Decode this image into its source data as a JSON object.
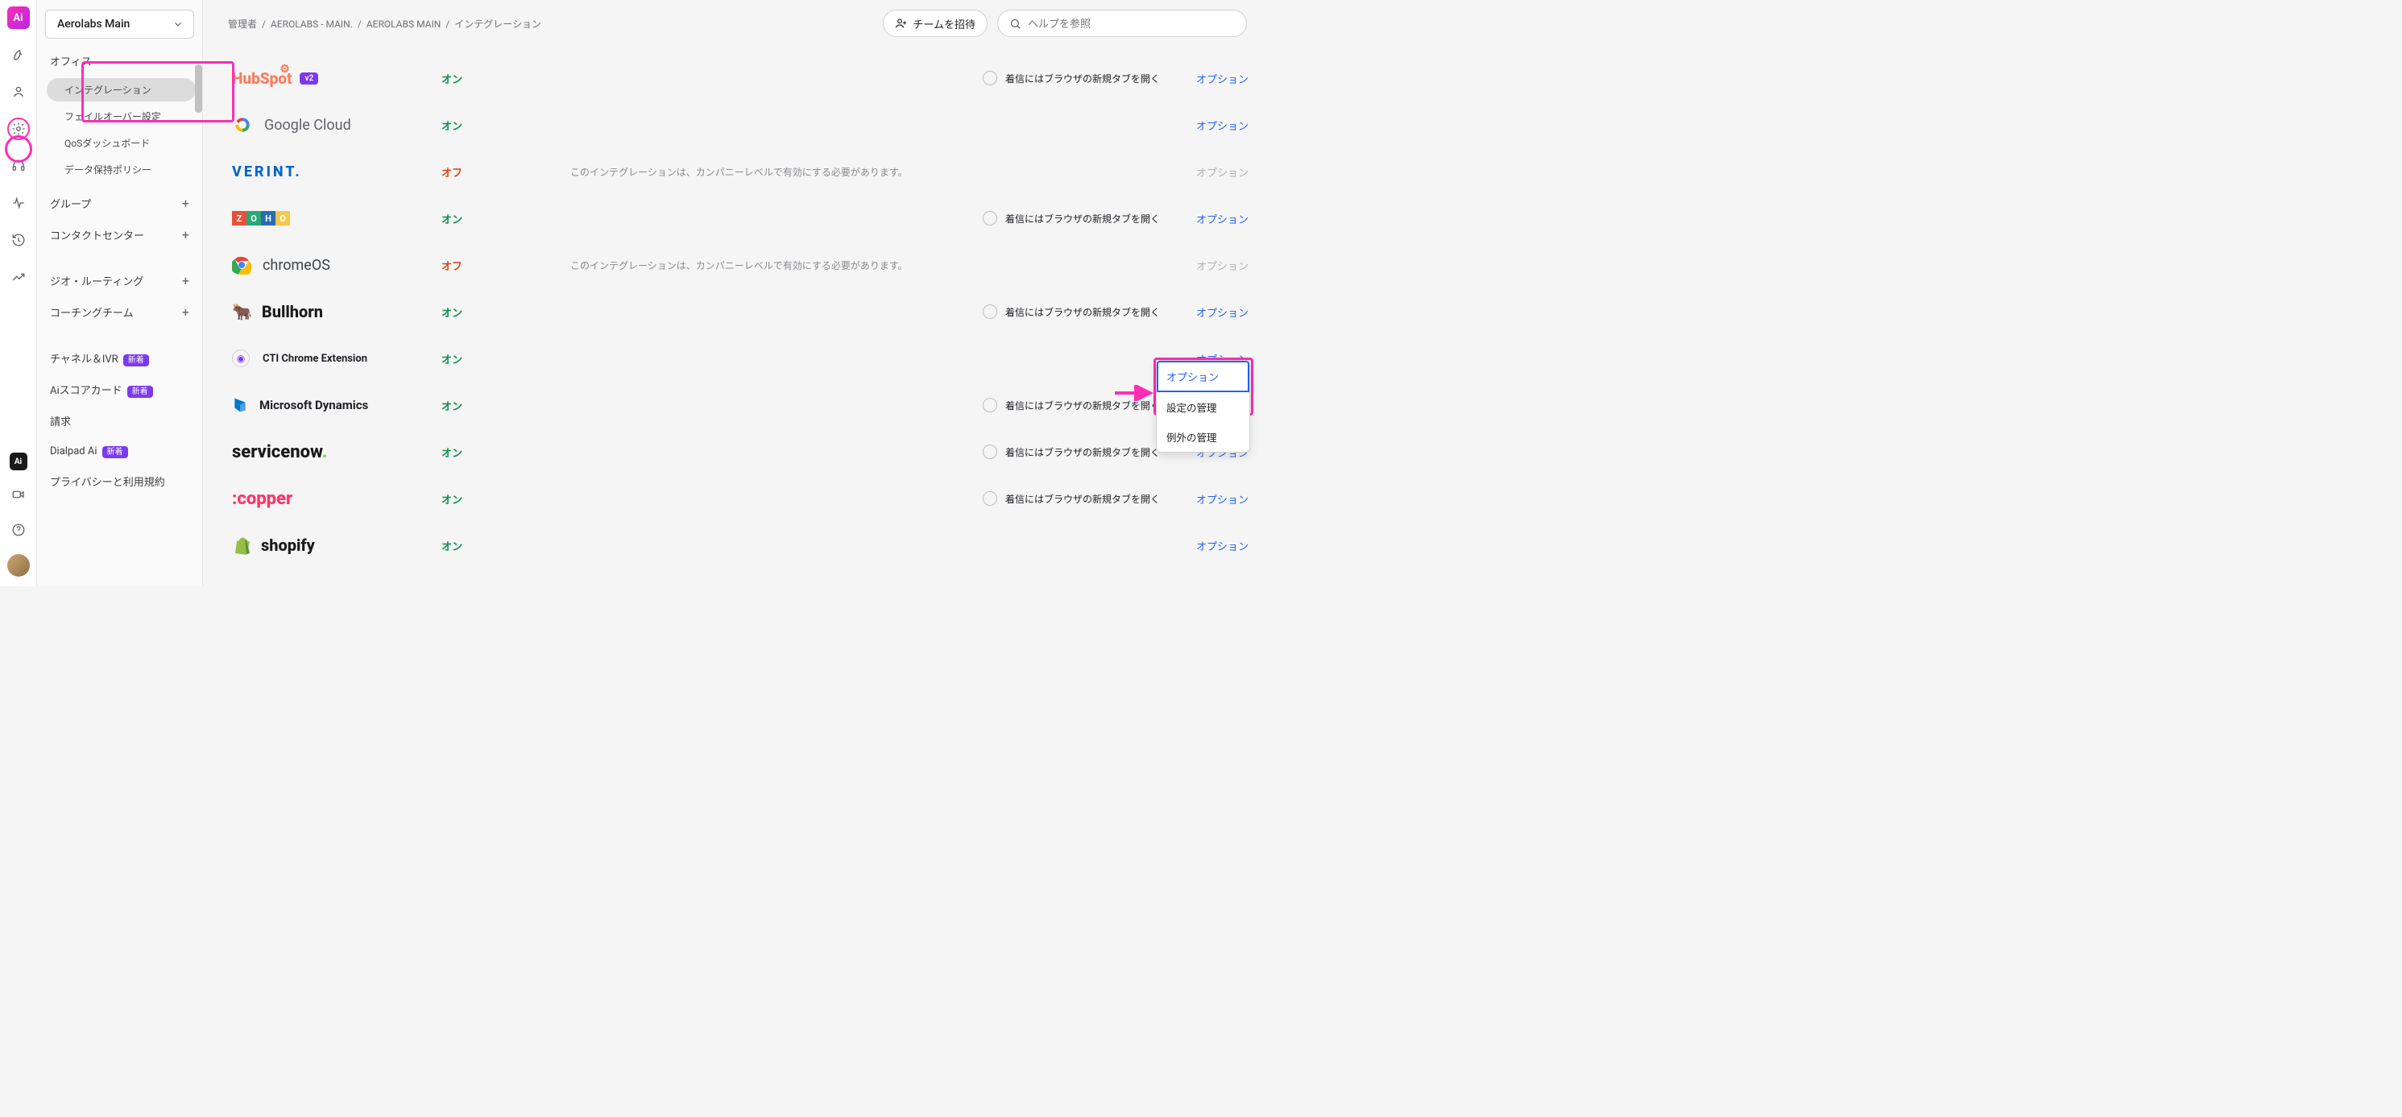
{
  "workspace": "Aerolabs Main",
  "breadcrumb": [
    "管理者",
    "AEROLABS - MAIN.",
    "AEROLABS MAIN",
    "インテグレーション"
  ],
  "invite_label": "チームを招待",
  "search_placeholder": "ヘルプを参照",
  "sidebar": {
    "office": "オフィス",
    "subs": [
      "インテグレーション",
      "フェイルオーバー設定",
      "QoSダッシュボード",
      "データ保持ポリシー"
    ],
    "items": [
      {
        "label": "グループ",
        "plus": true
      },
      {
        "label": "コンタクトセンター",
        "plus": true
      },
      {
        "label": "ジオ・ルーティング",
        "plus": true
      },
      {
        "label": "コーチングチーム",
        "plus": true
      },
      {
        "label": "チャネル＆IVR",
        "badge": "新着"
      },
      {
        "label": "Aiスコアカード",
        "badge": "新着"
      },
      {
        "label": "請求"
      },
      {
        "label": "Dialpad Ai",
        "badge": "新着"
      },
      {
        "label": "プライバシーと利用規約"
      }
    ]
  },
  "options_label": "オプション",
  "toggle_note": "着信にはブラウザの新規タブを開く",
  "company_note": "このインテグレーションは、カンパニーレベルで有効にする必要があります。",
  "status": {
    "on": "オン",
    "off": "オフ"
  },
  "dropdown": {
    "top": "オプション",
    "items": [
      "設定の管理",
      "例外の管理"
    ]
  },
  "integrations": [
    {
      "name": "HubSpot",
      "status": "on",
      "toggle": true,
      "opt": true,
      "v2": true
    },
    {
      "name": "Google Cloud",
      "status": "on",
      "toggle": false,
      "opt": true
    },
    {
      "name": "VERINT",
      "status": "off",
      "note": true,
      "opt": false
    },
    {
      "name": "Zoho",
      "status": "on",
      "toggle": true,
      "opt": true
    },
    {
      "name": "chromeOS",
      "status": "off",
      "note": true,
      "opt": false
    },
    {
      "name": "Bullhorn",
      "status": "on",
      "toggle": true,
      "opt": true
    },
    {
      "name": "CTI Chrome Extension",
      "status": "on",
      "toggle": false,
      "opt": true
    },
    {
      "name": "Microsoft Dynamics",
      "status": "on",
      "toggle": true,
      "opt": true
    },
    {
      "name": "servicenow",
      "status": "on",
      "toggle": true,
      "opt": true
    },
    {
      "name": "copper",
      "status": "on",
      "toggle": true,
      "opt": true
    },
    {
      "name": "shopify",
      "status": "on",
      "toggle": false,
      "opt": true
    }
  ]
}
